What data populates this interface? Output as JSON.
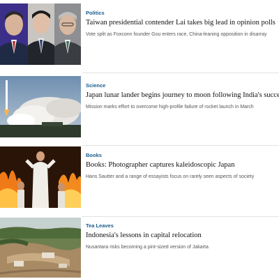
{
  "articles": [
    {
      "category": "Politics",
      "headline": "Taiwan presidential contender Lai takes big lead in opinion polls",
      "summary": "Vote split as Foxconn founder Gou enters race, China-leaning opposition in disarray",
      "image_subject": "portraits of three men in suits"
    },
    {
      "category": "Science",
      "headline": "Japan lunar lander begins journey to moon following India's success",
      "summary": "Mission marks effort to overcome high-profile failure of rocket launch in March",
      "image_subject": "rocket launch with smoke plume"
    },
    {
      "category": "Books",
      "headline": "Books: Photographer captures kaleidoscopic Japan",
      "summary": "Hans Sautter and a range of essayists focus on rarely seen aspects of society",
      "image_subject": "fire festival with performers in white"
    },
    {
      "category": "Tea Leaves",
      "headline": "Indonesia's lessons in capital relocation",
      "summary": "Nusantara risks becoming a pint-sized version of Jakarta",
      "image_subject": "aerial view of construction site in forest"
    }
  ],
  "colors": {
    "category": "#1a5c8c",
    "headline": "#111111",
    "summary": "#555555",
    "divider": "#e2e2e2"
  }
}
